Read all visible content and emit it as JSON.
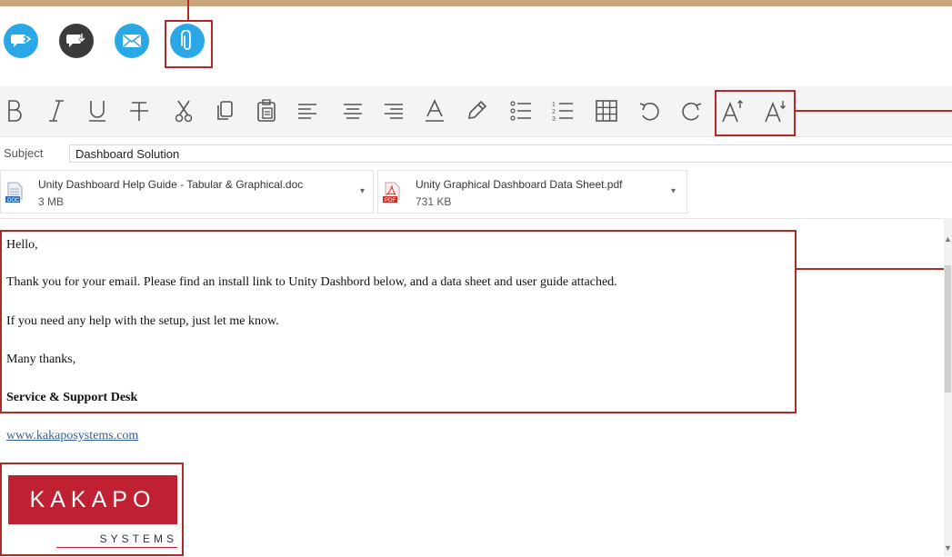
{
  "colors": {
    "top_bar": "#c9a57c",
    "callout": "#b02a2a",
    "action_blue": "#2aa7e6",
    "action_dark": "#3a3a3a",
    "logo_red": "#bf2132"
  },
  "actions": [
    {
      "icon": "reply-icon"
    },
    {
      "icon": "download-icon"
    },
    {
      "icon": "mail-icon"
    },
    {
      "icon": "paperclip-icon"
    }
  ],
  "toolbar": {
    "icons": [
      "bold-icon",
      "italic-icon",
      "underline-icon",
      "strikethrough-icon",
      "cut-icon",
      "copy-icon",
      "paste-icon",
      "align-left-icon",
      "align-center-icon",
      "align-right-icon",
      "font-color-icon",
      "highlight-icon",
      "bullet-list-icon",
      "numbered-list-icon",
      "table-icon",
      "undo-icon",
      "redo-icon",
      "increase-font-icon",
      "decrease-font-icon"
    ]
  },
  "subject": {
    "label": "Subject",
    "value": "Dashboard Solution"
  },
  "attachments": [
    {
      "name": "Unity Dashboard Help Guide - Tabular & Graphical.doc",
      "size": "3 MB",
      "icon": "doc-file-icon"
    },
    {
      "name": "Unity Graphical Dashboard Data Sheet.pdf",
      "size": "731 KB",
      "icon": "pdf-file-icon"
    }
  ],
  "body": {
    "greeting": "Hello,",
    "line1": "Thank you for your email. Please find an install link to Unity Dashbord below, and a data sheet and user guide attached.",
    "line2": "If you need any help with the setup, just let me know.",
    "closing": "Many thanks,",
    "signature": "Service & Support Desk",
    "link": "www.kakaposystems.com"
  },
  "logo": {
    "name": "KAKAPO",
    "sub": "SYSTEMS"
  }
}
